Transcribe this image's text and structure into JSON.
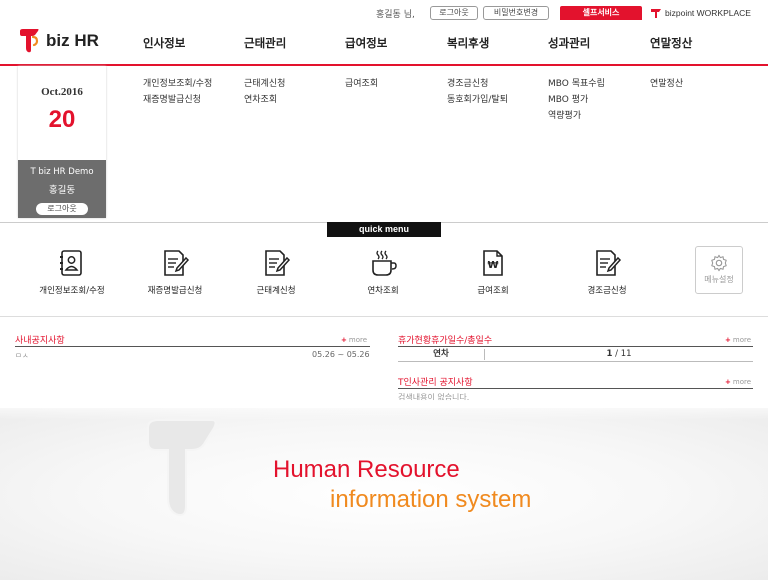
{
  "topbar": {
    "greeting": "홍길동 님,",
    "logout_label": "로그아웃",
    "change_pw_label": "비밀번호변경",
    "self_service_label": "셀프서비스",
    "bizpoint_label": "bizpoint WORKPLACE"
  },
  "logo": {
    "text": "biz HR"
  },
  "nav": [
    {
      "label": "인사정보"
    },
    {
      "label": "근태관리"
    },
    {
      "label": "급여정보"
    },
    {
      "label": "복리후생"
    },
    {
      "label": "성과관리"
    },
    {
      "label": "연말정산"
    }
  ],
  "submenu": [
    [
      "개인정보조회/수정",
      "재증명발급신청"
    ],
    [
      "근태계신청",
      "연차조회"
    ],
    [
      "급여조회"
    ],
    [
      "경조금신청",
      "동호회가입/탈퇴"
    ],
    [
      "MBO 목표수립",
      "MBO 평가",
      "역량평가"
    ],
    [
      "연말정산"
    ]
  ],
  "datebox": {
    "month": "Oct.2016",
    "day": "20",
    "company": "T biz HR Demo",
    "user": "홍길동",
    "logout_label": "로그아웃"
  },
  "quick_menu": {
    "label": "quick menu",
    "items": [
      {
        "label": "개인정보조회/수정",
        "icon": "id-card-icon"
      },
      {
        "label": "재증명발급신청",
        "icon": "document-edit-icon"
      },
      {
        "label": "근태계신청",
        "icon": "document-edit-icon"
      },
      {
        "label": "연차조회",
        "icon": "coffee-cup-icon"
      },
      {
        "label": "급여조회",
        "icon": "won-document-icon"
      },
      {
        "label": "경조금신청",
        "icon": "document-edit-icon"
      }
    ],
    "setting_label": "메뉴설정"
  },
  "boards": {
    "notice": {
      "title": "사내공지사항",
      "more": "more",
      "row_text": "ㅁㅅ",
      "row_date": "05.26 ~ 05.26"
    },
    "vacation": {
      "title": "휴가현황휴가일수/총일수",
      "more": "more",
      "col_label": "연차",
      "used": "1",
      "sep": " / ",
      "total": "11"
    },
    "hr_notice": {
      "title": "T인사관리 공지사항",
      "more": "more",
      "empty_text": "검색내용이 없습니다."
    }
  },
  "hero": {
    "line1": "Human Resource",
    "line2": "information system"
  },
  "colors": {
    "brand_red": "#e3122d",
    "brand_orange": "#f08a1f",
    "dark_gray": "#6d6d6d"
  }
}
